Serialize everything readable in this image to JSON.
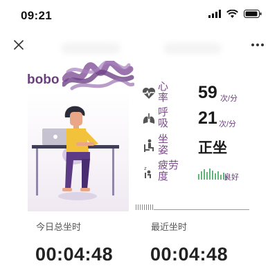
{
  "status_bar": {
    "time": "09:21"
  },
  "user": {
    "name": "bobo"
  },
  "metrics": {
    "heart_rate": {
      "label": "心率",
      "value": "59",
      "unit": "次/分"
    },
    "respiration": {
      "label": "呼吸",
      "value": "21",
      "unit": "次/分"
    },
    "posture": {
      "label": "坐姿",
      "value": "正坐"
    },
    "fatigue": {
      "label": "疲劳度",
      "status": "良好"
    }
  },
  "stats": {
    "today_label": "今日总坐时",
    "today_value": "00:04:48",
    "recent_label": "最近坐时",
    "recent_value": "00:04:48"
  },
  "colors": {
    "accent": "#7b4a8c",
    "fatigue_good": "#5fb57a",
    "icon": "#555555"
  }
}
